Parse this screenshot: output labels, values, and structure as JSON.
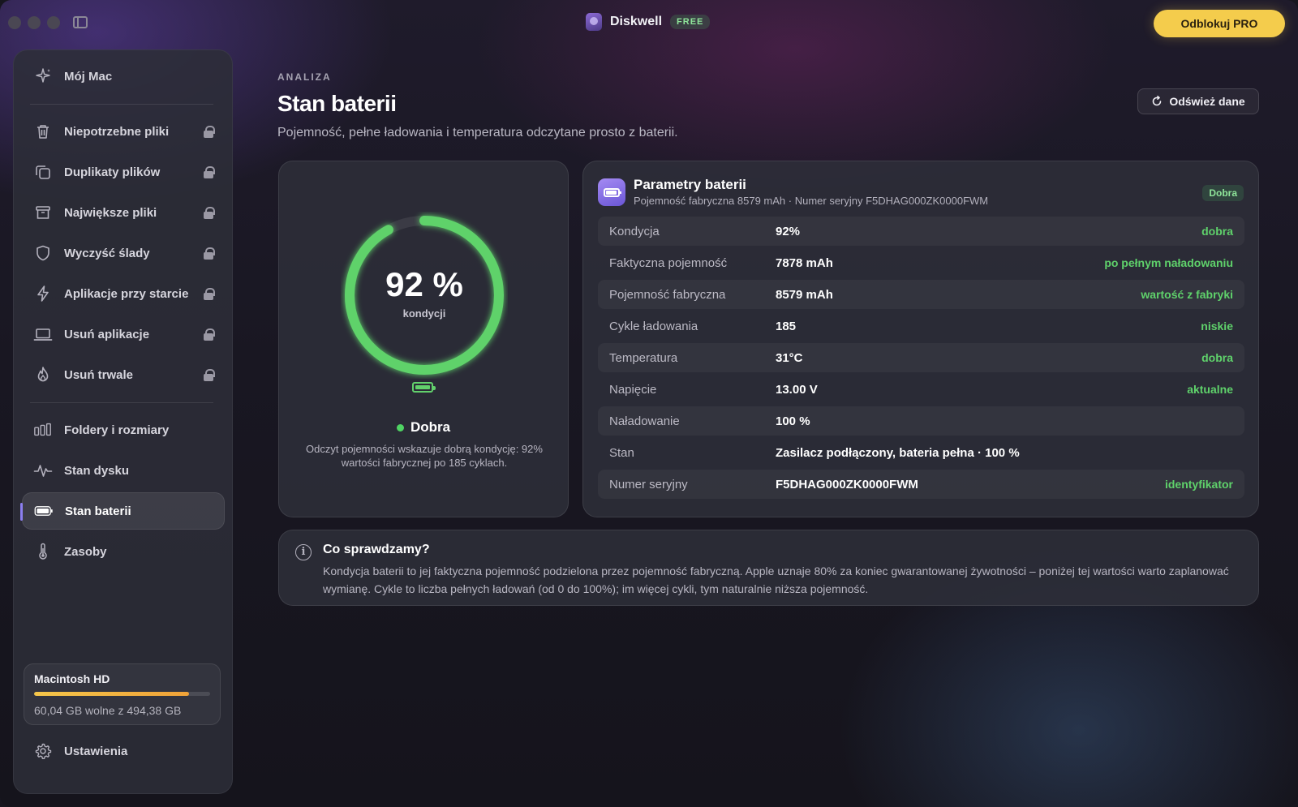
{
  "titlebar": {
    "app_name": "Diskwell",
    "plan_badge": "FREE",
    "pro_button": "Odblokuj PRO"
  },
  "sidebar": {
    "home": {
      "label": "Mój Mac",
      "icon": "sparkles-icon"
    },
    "items": [
      {
        "label": "Niepotrzebne pliki",
        "icon": "trash-icon",
        "locked": true
      },
      {
        "label": "Duplikaty plików",
        "icon": "duplicate-icon",
        "locked": true
      },
      {
        "label": "Największe pliki",
        "icon": "archive-box-icon",
        "locked": true
      },
      {
        "label": "Wyczyść ślady",
        "icon": "shield-icon",
        "locked": true
      },
      {
        "label": "Aplikacje przy starcie",
        "icon": "bolt-icon",
        "locked": true
      },
      {
        "label": "Usuń aplikacje",
        "icon": "laptop-icon",
        "locked": true
      },
      {
        "label": "Usuń trwale",
        "icon": "flame-icon",
        "locked": true
      }
    ],
    "tools": [
      {
        "label": "Foldery i rozmiary",
        "icon": "bars-chart-icon"
      },
      {
        "label": "Stan dysku",
        "icon": "pulse-icon"
      },
      {
        "label": "Stan baterii",
        "icon": "battery-icon",
        "active": true
      },
      {
        "label": "Zasoby",
        "icon": "thermometer-icon"
      }
    ],
    "disk": {
      "name": "Macintosh HD",
      "free_text": "60,04 GB wolne z 494,38 GB",
      "used_fraction": 0.88
    },
    "settings": {
      "label": "Ustawienia",
      "icon": "gear-icon"
    }
  },
  "header": {
    "eyebrow": "ANALIZA",
    "title": "Stan baterii",
    "subtitle": "Pojemność, pełne ładowania i temperatura odczytane prosto z baterii.",
    "refresh_button": "Odśwież dane"
  },
  "gauge": {
    "value_text": "92 %",
    "value_fraction": 0.92,
    "caption": "kondycji",
    "status": "Dobra",
    "description": "Odczyt pojemności wskazuje dobrą kondycję: 92% wartości fabrycznej po 185 cyklach."
  },
  "params": {
    "title": "Parametry baterii",
    "subtitle": "Pojemność fabryczna 8579 mAh · Numer seryjny F5DHAG000ZK0000FWM",
    "badge": "Dobra",
    "rows": [
      {
        "label": "Kondycja",
        "value": "92%",
        "note": "dobra"
      },
      {
        "label": "Faktyczna pojemność",
        "value": "7878 mAh",
        "note": "po pełnym naładowaniu"
      },
      {
        "label": "Pojemność fabryczna",
        "value": "8579 mAh",
        "note": "wartość z fabryki"
      },
      {
        "label": "Cykle ładowania",
        "value": "185",
        "note": "niskie"
      },
      {
        "label": "Temperatura",
        "value": "31°C",
        "note": "dobra"
      },
      {
        "label": "Napięcie",
        "value": "13.00 V",
        "note": "aktualne"
      },
      {
        "label": "Naładowanie",
        "value": "100 %",
        "note": ""
      },
      {
        "label": "Stan",
        "value": "Zasilacz podłączony, bateria pełna · 100 %",
        "note": ""
      },
      {
        "label": "Numer seryjny",
        "value": "F5DHAG000ZK0000FWM",
        "note": "identyfikator"
      }
    ]
  },
  "info": {
    "title": "Co sprawdzamy?",
    "body": "Kondycja baterii to jej faktyczna pojemność podzielona przez pojemność fabryczną. Apple uznaje 80% za koniec gwarantowanej żywotności – poniżej tej wartości warto zaplanować wymianę. Cykle to liczba pełnych ładowań (od 0 do 100%); im więcej cykli, tym naturalnie niższa pojemność."
  },
  "colors": {
    "accent_green": "#5fd26b",
    "pro_yellow": "#f4cc4c",
    "active_indicator": "#8c7ff0"
  }
}
